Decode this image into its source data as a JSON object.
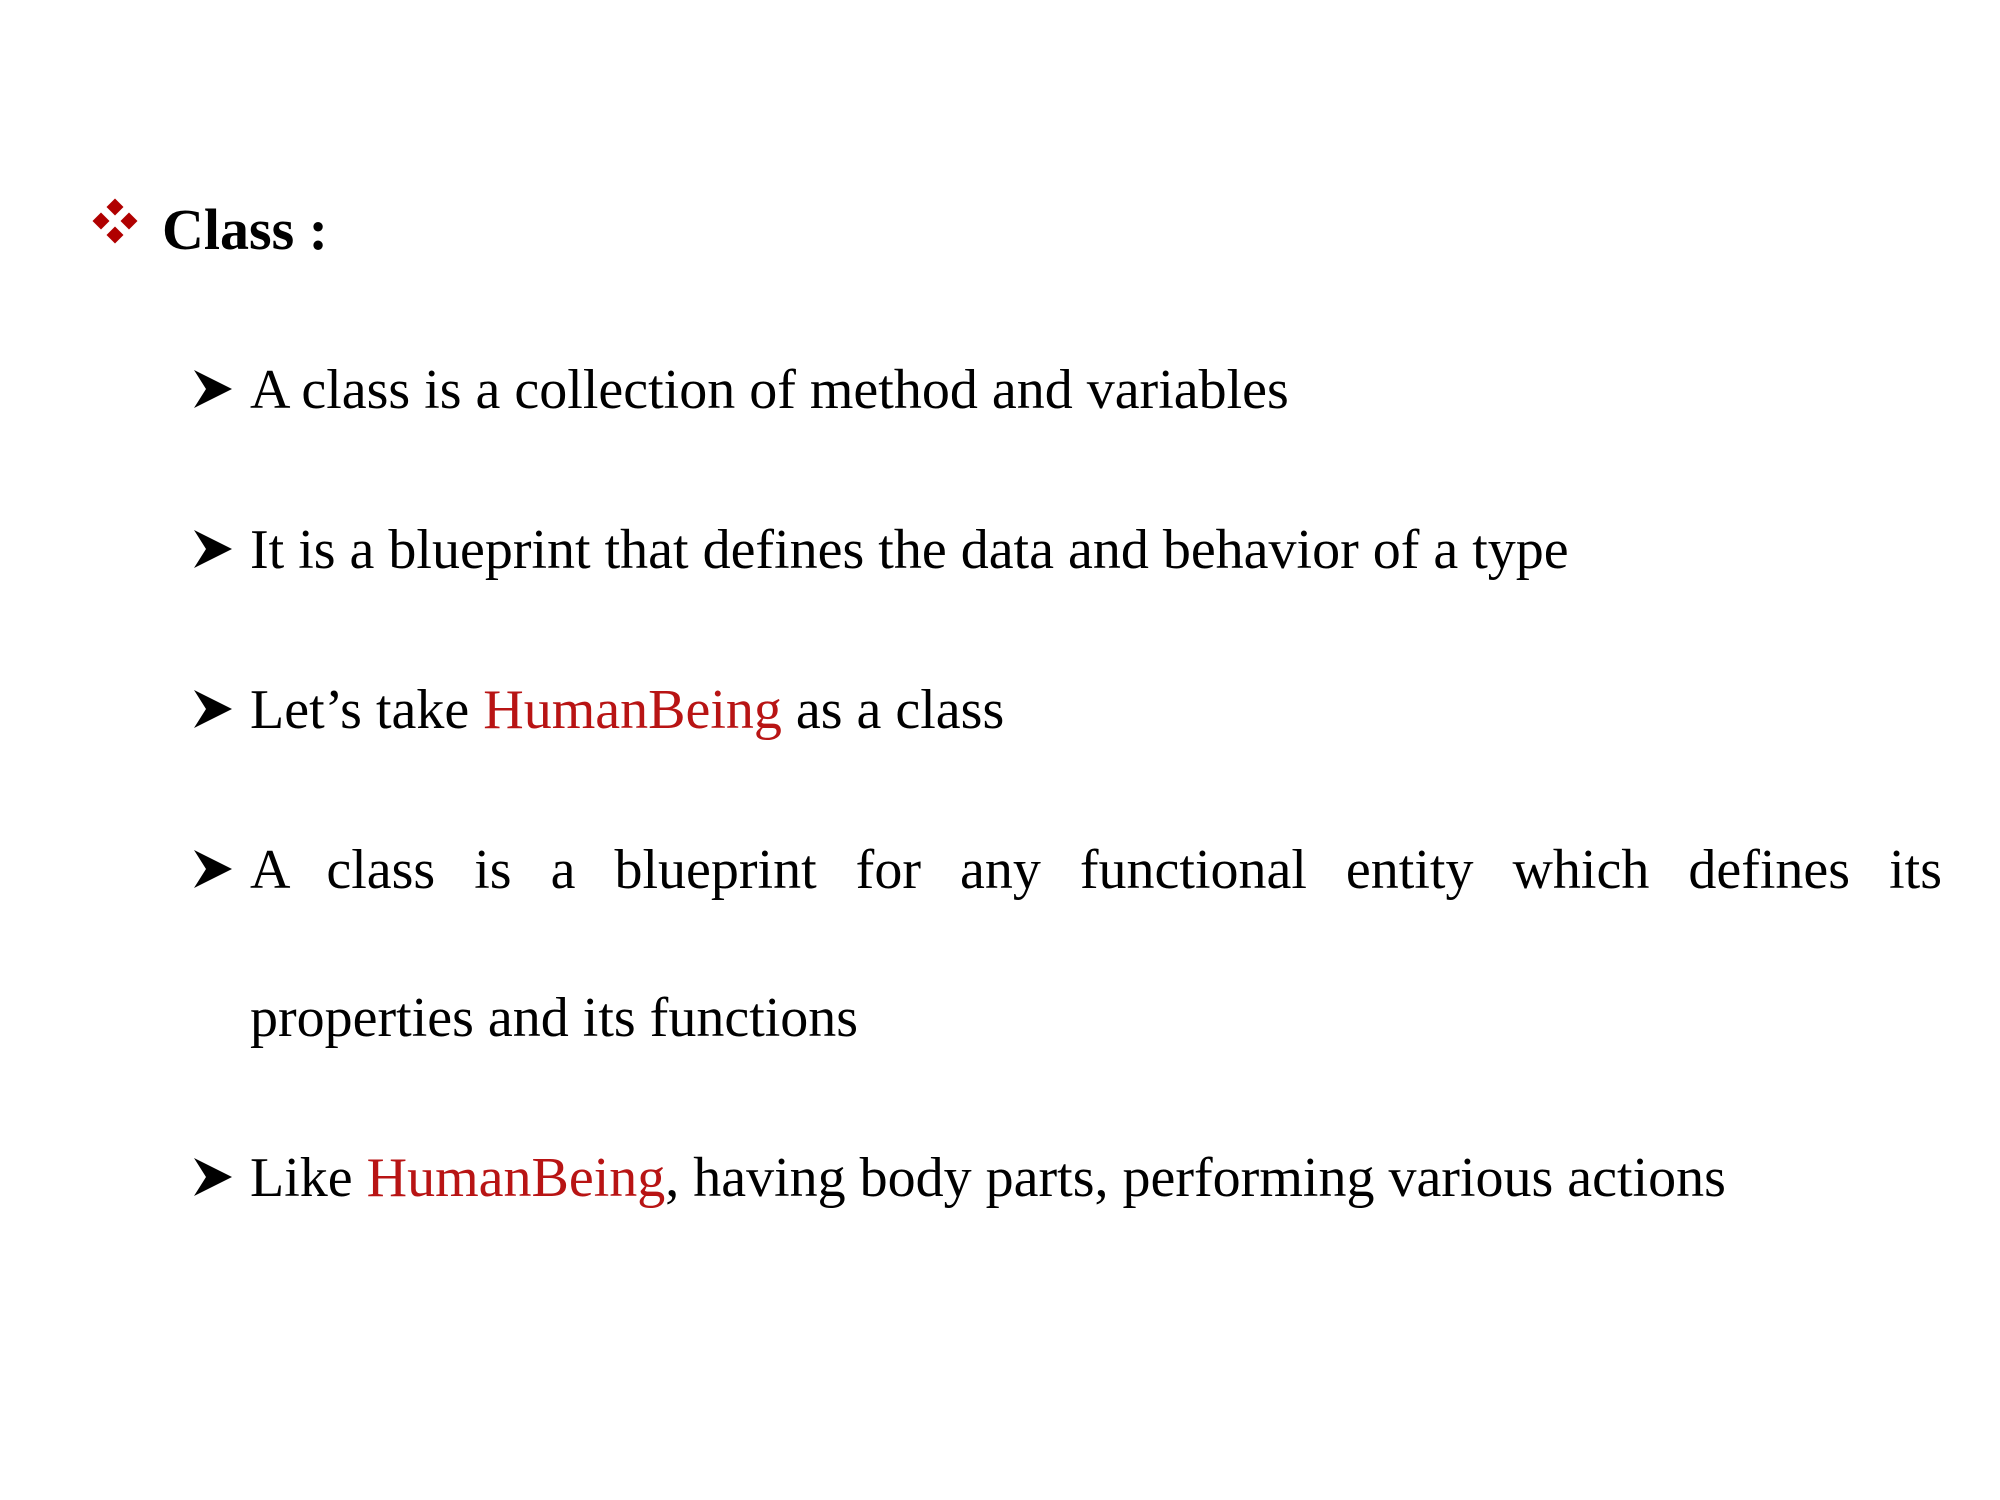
{
  "heading": {
    "text": "Class :",
    "bullet_icon": "four-diamonds-icon",
    "bullet_color": "#b00000"
  },
  "highlight_color": "#b81414",
  "bullets": [
    {
      "text": "A class is a collection of method and variables"
    },
    {
      "text": "It is a blueprint that defines the data and behavior of a type"
    },
    {
      "before": "Let’s take ",
      "highlight": "HumanBeing",
      "after": " as a class"
    },
    {
      "line1": "A class is a blueprint for any functional entity which defines its",
      "line2": "properties and its functions"
    },
    {
      "before": "Like ",
      "highlight": "HumanBeing",
      "after": ", having body parts, performing various actions"
    }
  ],
  "bullet_icon": "arrowhead-icon"
}
